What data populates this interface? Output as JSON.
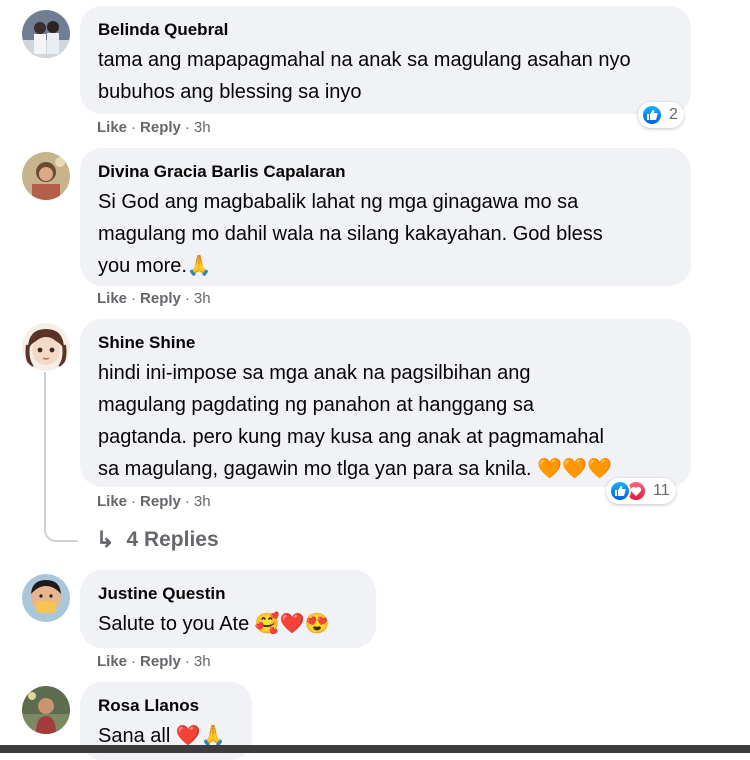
{
  "comments": [
    {
      "author": "Belinda Quebral",
      "text": "tama ang mapapagmahal na anak sa magulang asahan nyo\nbubuhos ang blessing sa inyo",
      "like": "Like",
      "reply": "Reply",
      "time": "3h",
      "reaction_count": "2"
    },
    {
      "author": "Divina Gracia Barlis Capalaran",
      "text": "Si God ang magbabalik lahat ng mga ginagawa mo sa\nmagulang mo dahil wala na silang kakayahan. God bless\nyou more.🙏",
      "like": "Like",
      "reply": "Reply",
      "time": "3h"
    },
    {
      "author": "Shine Shine",
      "text": "hindi ini-impose sa mga anak na pagsilbihan ang\nmagulang pagdating ng panahon at hanggang sa\npagtanda. pero kung may kusa ang anak at pagmamahal\nsa magulang, gagawin mo tlga yan para sa knila. 🧡🧡🧡",
      "like": "Like",
      "reply": "Reply",
      "time": "3h",
      "reaction_count": "11",
      "replies_label": "4 Replies"
    },
    {
      "author": "Justine Questin",
      "text": "Salute to you Ate 🥰❤️😍",
      "like": "Like",
      "reply": "Reply",
      "time": "3h"
    },
    {
      "author": "Rosa Llanos",
      "text": "Sana all ❤️🙏"
    }
  ],
  "colors": {
    "bubble": "#f0f2f5",
    "meta_text": "#65676b",
    "like_blue": "#0062df",
    "love_red": "#e61739"
  },
  "icons": {
    "reply_arrow": "↳"
  }
}
